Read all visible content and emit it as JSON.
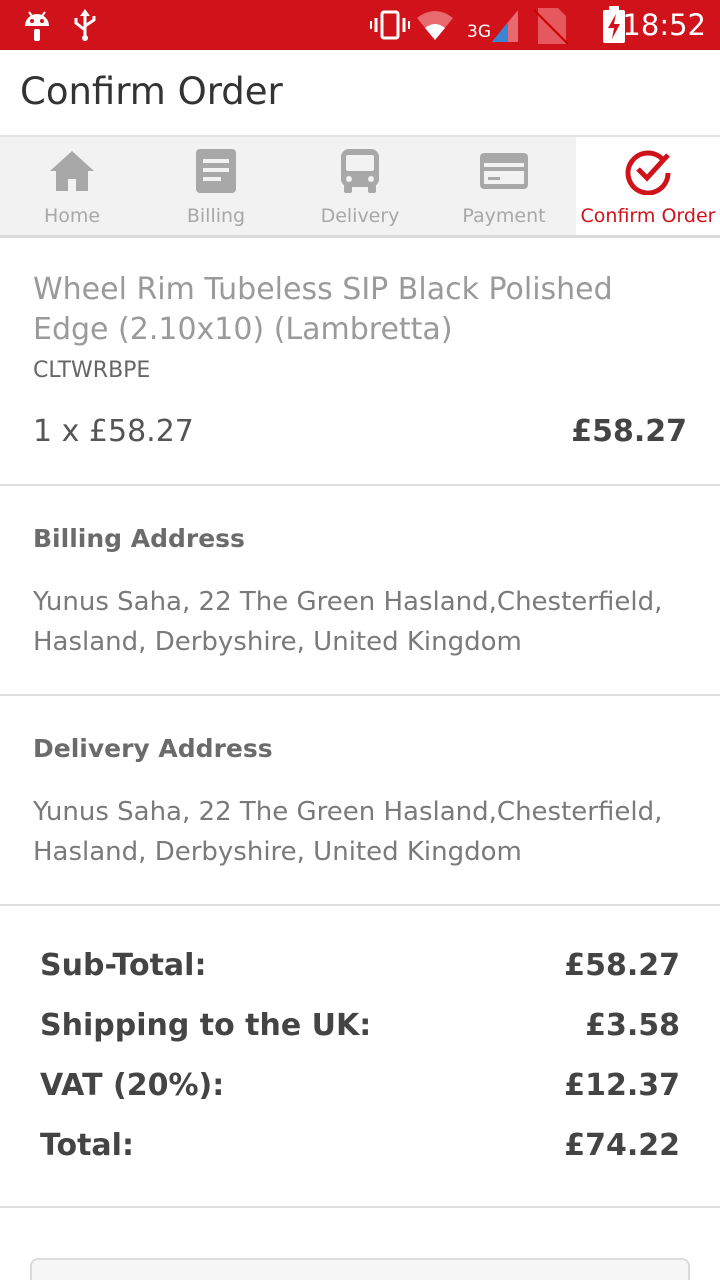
{
  "status_bar": {
    "time": "18:52",
    "network": "3G",
    "icons": [
      "android-icon",
      "usb-icon",
      "vibrate-icon",
      "wifi-icon",
      "signal-icon",
      "no-sim-icon",
      "battery-charging-icon"
    ]
  },
  "app_bar": {
    "title": "Confirm Order"
  },
  "steps": [
    {
      "label": "Home",
      "icon": "home-icon",
      "active": false
    },
    {
      "label": "Billing",
      "icon": "document-icon",
      "active": false
    },
    {
      "label": "Delivery",
      "icon": "bus-icon",
      "active": false
    },
    {
      "label": "Payment",
      "icon": "credit-card-icon",
      "active": false
    },
    {
      "label": "Confirm Order",
      "icon": "check-circle-icon",
      "active": true
    }
  ],
  "product": {
    "name": "Wheel Rim Tubeless SIP Black Polished Edge (2.10x10) (Lambretta)",
    "sku": "CLTWRBPE",
    "quantity_price": "1 x £58.27",
    "line_total": "£58.27"
  },
  "billing": {
    "title": "Billing Address",
    "address": "Yunus Saha, 22 The Green Hasland,Chesterfield, Hasland, Derbyshire, United Kingdom"
  },
  "delivery": {
    "title": "Delivery Address",
    "address": "Yunus Saha, 22 The Green Hasland,Chesterfield, Hasland, Derbyshire, United Kingdom"
  },
  "totals": [
    {
      "label": "Sub-Total:",
      "value": "£58.27"
    },
    {
      "label": "Shipping to the UK:",
      "value": "£3.58"
    },
    {
      "label": "VAT (20%):",
      "value": "£12.37"
    },
    {
      "label": "Total:",
      "value": "£74.22"
    }
  ],
  "colors": {
    "brand": "#d0121b",
    "inactive": "#a8a8a8"
  }
}
